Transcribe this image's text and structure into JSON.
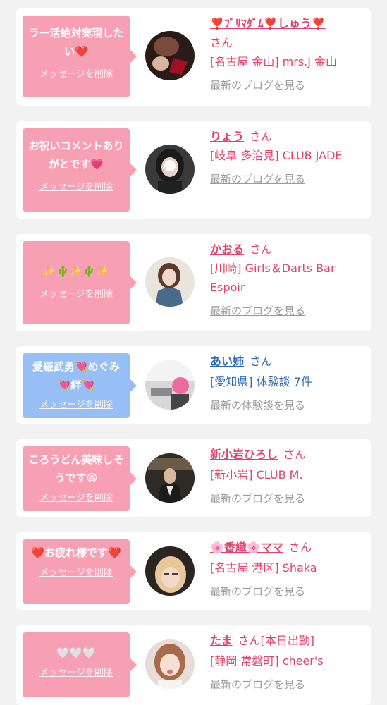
{
  "cards": [
    {
      "message": "ラー活絶対実現したい❤️",
      "delete_label": "メッセージを削除",
      "name": "❣️ﾌﾟﾘﾏﾀﾞﾑ❣️しゅう❣️",
      "honorific": "さん",
      "location": "[名古屋 金山] mrs.J 金山",
      "link": "最新のブログを見る"
    },
    {
      "message": "お祝いコメントありがとです💗",
      "delete_label": "メッセージを削除",
      "name": "りょう",
      "honorific": "さん",
      "location": "[岐阜 多治見] CLUB JADE",
      "link": "最新のブログを見る"
    },
    {
      "message": "✨🌵✨🌵✨",
      "delete_label": "メッセージを削除",
      "name": "かおる",
      "honorific": "さん",
      "location": "[川崎] Girls＆Darts Bar Espoir",
      "link": "最新のブログを見る"
    },
    {
      "message": "愛羅武勇💘めぐみ💘絆💘",
      "delete_label": "メッセージを削除",
      "name": "あい姉",
      "honorific": "さん",
      "location": "[愛知県] 体験談 7件",
      "link": "最新の体験談を見る"
    },
    {
      "message": "ころうどん美味しそうです😄",
      "delete_label": "メッセージを削除",
      "name": "新小岩ひろし",
      "honorific": "さん",
      "location": "[新小岩] CLUB M.",
      "link": "最新のブログを見る"
    },
    {
      "message": "❤️お疲れ様です❤️",
      "delete_label": "メッセージを削除",
      "name": "🌸香織🌸ママ",
      "honorific": "さん",
      "location": "[名古屋 港区] Shaka",
      "link": "最新のブログを見る"
    },
    {
      "message": "🤍🤍🤍",
      "delete_label": "メッセージを削除",
      "name": "たま",
      "honorific": "さん[本日出勤]",
      "location": "[静岡 常磐町] cheer's",
      "link": "最新のブログを見る"
    }
  ],
  "colors": {
    "pink_bubble": "#f7a0b4",
    "blue_bubble": "#98bff5",
    "pink_text": "#e5416b",
    "blue_text": "#2c6bb3",
    "link_gray": "#9b9b9b"
  }
}
